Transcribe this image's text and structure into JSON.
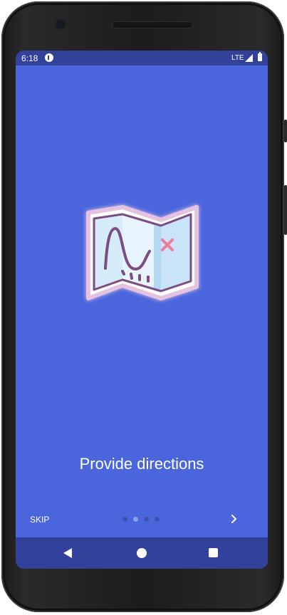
{
  "status_bar": {
    "time": "6:18",
    "network": "LTE",
    "icons": [
      "notification-icon",
      "signal-icon",
      "battery-icon"
    ]
  },
  "onboarding": {
    "illustration": "map-icon",
    "title": "Provide directions",
    "skip_label": "SKIP",
    "next_icon": "chevron-right-icon",
    "page_count": 4,
    "current_page": 2
  },
  "nav_bar": {
    "buttons": [
      "back-icon",
      "home-icon",
      "recents-icon"
    ]
  },
  "colors": {
    "background": "#4b66dd",
    "bars": "#32429a",
    "dot_active": "#8da0ec",
    "dot_inactive": "#3d53b3",
    "map_x": "#f07a9a"
  }
}
